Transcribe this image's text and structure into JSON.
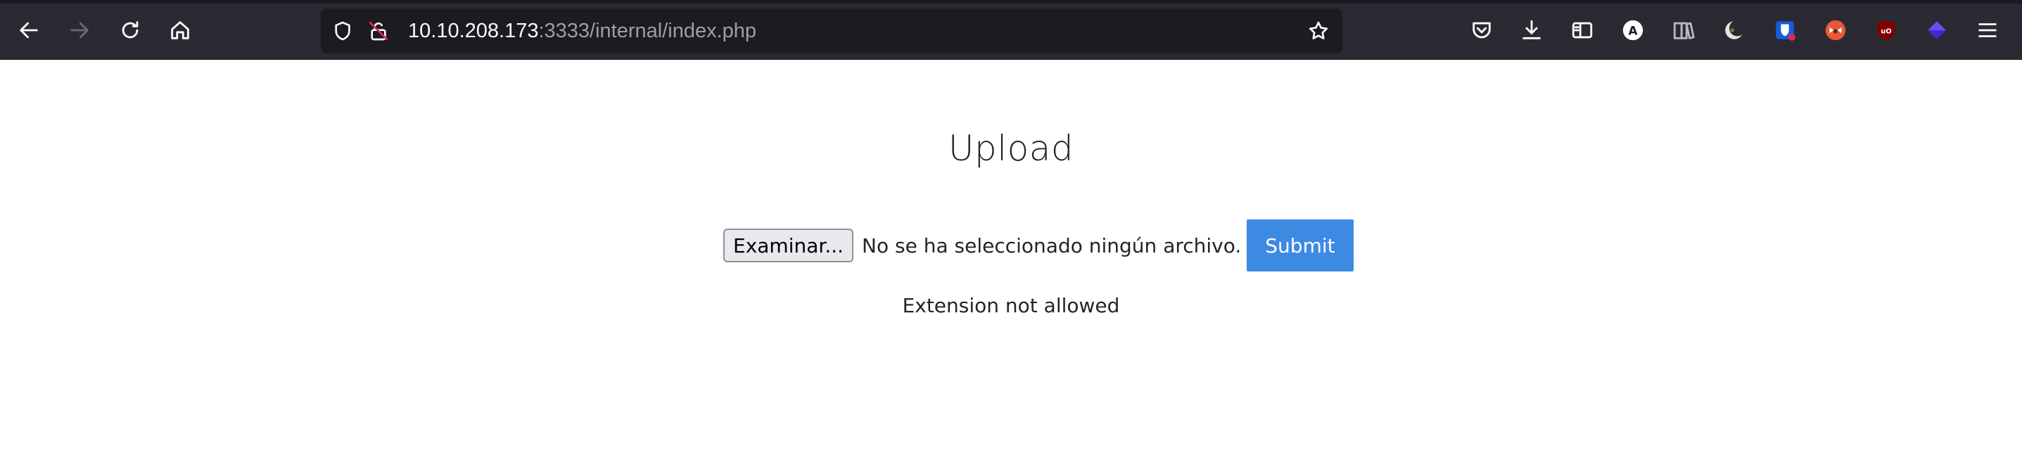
{
  "browser": {
    "url_host": "10.10.208.173",
    "url_rest": ":3333/internal/index.php",
    "icons": {
      "back": "back-arrow-icon",
      "forward": "forward-arrow-icon",
      "reload": "reload-icon",
      "home": "home-icon",
      "tracking": "shield-icon",
      "insecure": "insecure-lock-icon",
      "bookmark": "star-icon",
      "pocket": "pocket-icon",
      "downloads": "download-icon",
      "sidebar": "sidebar-icon",
      "menu": "hamburger-menu-icon"
    },
    "extensions": {
      "first_letter": "A"
    }
  },
  "page": {
    "heading": "Upload",
    "file_button_label": "Examinar...",
    "file_status": "No se ha seleccionado ningún archivo.",
    "submit_label": "Submit",
    "message": "Extension not allowed"
  },
  "colors": {
    "chrome_bg": "#2b2a33",
    "urlbar_bg": "#1c1b22",
    "submit_bg": "#3d8ae3"
  }
}
